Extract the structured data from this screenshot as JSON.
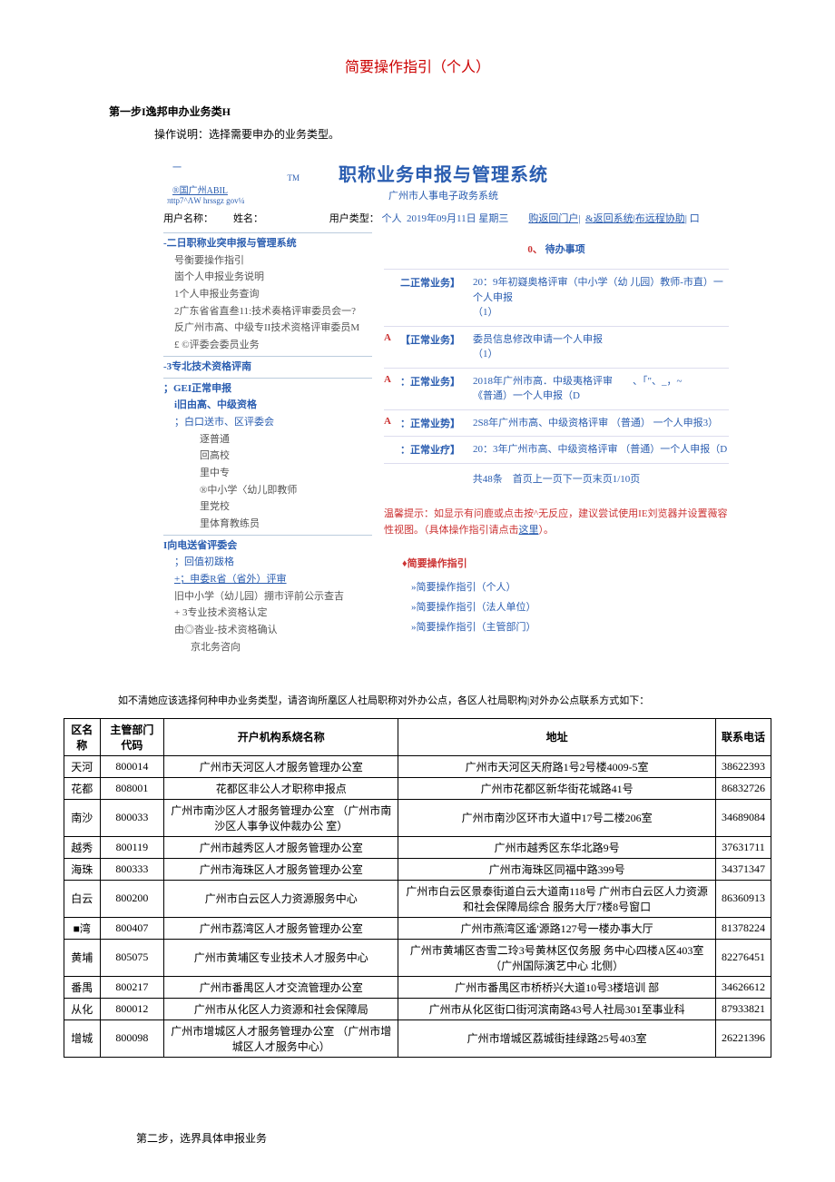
{
  "doc": {
    "title": "简要操作指引（个人）",
    "step1_heading": "第一步I逸邦申办业务类H",
    "step1_instruction": "操作说明：选择需要申办的业务类型。",
    "step2_heading": "第二步，选界具体申报业务"
  },
  "logo": {
    "line1": "一",
    "tm": "TM",
    "brand": "®国广州ABIL",
    "url": "πttp7^ΛW hrssgz gov¼"
  },
  "system": {
    "title": "职称业务申报与管理系统",
    "subtitle": "广州市人事电子政务系统"
  },
  "userbar": {
    "username_label": "用户名称：",
    "name_label": "姓名：",
    "usertype_label": "用户类型：",
    "usertype_value": "个人",
    "date": "2019年09月11日 星期三",
    "return_portal": "购返回门户|",
    "return_system": "&返回系统|布远程协助|",
    "box": "口"
  },
  "sidebar": {
    "s1": "-二日职称业突申报与管理系统",
    "i1": "号衡要操作指引",
    "i2": "崮个人申报业务说明",
    "i3": "1个人申报业务查询",
    "i4": "2广东省省直叁11:技术奏格评审委员会一?",
    "i5": "反广州市高、中级专II技术资格评审委员M",
    "i6": "£ ©评委会委员业务",
    "s2": "-3专北技术资格评南",
    "s3": "；GEI正常申报",
    "i7": "i旧由高、中级资格",
    "i8": "；白⼝送市、区评委会",
    "i9": "逐普通",
    "i10": "回高校",
    "i11": "里中专",
    "i12": "®中小学〈幼儿即教师",
    "i13": "里党校",
    "i14": "里体育教练员",
    "s4": "I向电送省评委会",
    "i15": "；回值初跋格",
    "i16": "+；申委R省（省外）评审",
    "i17": "旧中小学（幼儿园）掤市评前公示查吉",
    "i18": "+ 3专业技术资格认定",
    "i19": "由◎沓业-技术资格确认",
    "i20": "京北务咨向"
  },
  "pending": {
    "heading_num": "0、",
    "heading_text": "待办事项",
    "rows": [
      {
        "badge": "",
        "kind": "二正常业务】",
        "desc": "20：9年初嶷奥格评审（中小学（幼 儿园）教师-市直）一个人申报\n（1）"
      },
      {
        "badge": "A",
        "kind": "【正常业务】",
        "desc": "委员信息修改申请一个人申报\n（1）"
      },
      {
        "badge": "A",
        "kind": "：正常业务】",
        "desc": "2018年广州市高．中级夷格评审　　、「\"、_，~\n《普通）一个人申报（D"
      },
      {
        "badge": "A",
        "kind": "：正常业势】",
        "desc": "2S8年广州市高、中级资格评审 （普通） 一个人申报3）"
      },
      {
        "badge": "",
        "kind": "：正常业疗】",
        "desc": "20：3年广州市高、中级资格评审 （普通）一个人申报（D"
      }
    ],
    "pager": "共48条　首页上一页下一页末页1/10页",
    "hint_pre": "温馨提示：如显示有问鹿或点击按^无反应，建议尝试使用IE刘览器并设置薇容性视图。（具体操作指引请点击",
    "hint_link": "这里",
    "hint_post": "）。",
    "guide_head": "♦简要操作指引",
    "guide_items": [
      "»简要操作指引（个人）",
      "»简要操作指引（法人单位）",
      "»简要操作指引（主管部门）"
    ]
  },
  "consult": "如不清她应该选择何种申办业务类型，请咨询所凰区人社局职称对外办公点，各区人社局职构|对外办公点联系方式如下：",
  "table": {
    "headers": [
      "区名称",
      "主管部门代码",
      "开户机构系烧名称",
      "地址",
      "联系电话"
    ],
    "rows": [
      [
        "天河",
        "800014",
        "广州市天河区人才服务管理办公室",
        "广州市天河区天府路1号2号楼4009-5室",
        "38622393"
      ],
      [
        "花都",
        "808001",
        "花都区非公人才职称申报点",
        "广州市花都区新华街花城路41号",
        "86832726"
      ],
      [
        "南沙",
        "800033",
        "广州市南沙区人才服务管理办公室 （广州市南沙区人事争议仲裁办公 室）",
        "广州市南沙区环市大道中17号二楼206室",
        "34689084"
      ],
      [
        "越秀",
        "800119",
        "广州市越秀区人才服务管理办公室",
        "广州市越秀区东华北路9号",
        "37631711"
      ],
      [
        "海珠",
        "800333",
        "广州市海珠区人才服务管理办公室",
        "广州市海珠区同福中路399号",
        "34371347"
      ],
      [
        "白云",
        "800200",
        "广州市白云区人力资源服务中心",
        "广州市白云区景泰街道白云大道南118号 广州市白云区人力资源和社会保障局综合 服务大厅7楼8号窗口",
        "86360913"
      ],
      [
        "■湾",
        "800407",
        "广州市荔湾区人才服务管理办公室",
        "广州市燕湾区遙'源路127号一楼办事大厅",
        "81378224"
      ],
      [
        "黄埔",
        "805075",
        "广州市黄埔区专业技术人才服务中心",
        "广州市黄埔区杏雪二玲3号黄林区仅务服 务中心四楼A区403室（广州国际演艺中心 北侧）",
        "82276451"
      ],
      [
        "番禺",
        "800217",
        "广州市番禺区人才交流管理办公室",
        "广州市番禺区市桥桥兴大道10号3楼培训 部",
        "34626612"
      ],
      [
        "从化",
        "800012",
        "广州市从化区人力资源和社会保障局",
        "广州市从化区街口街河滨南路43号人社局301至事业科",
        "87933821"
      ],
      [
        "增城",
        "800098",
        "广州市增城区人才服务管理办公室 （广州市增城区人才服务中心）",
        "广州市增城区荔城街挂绿路25号403室",
        "26221396"
      ]
    ]
  }
}
